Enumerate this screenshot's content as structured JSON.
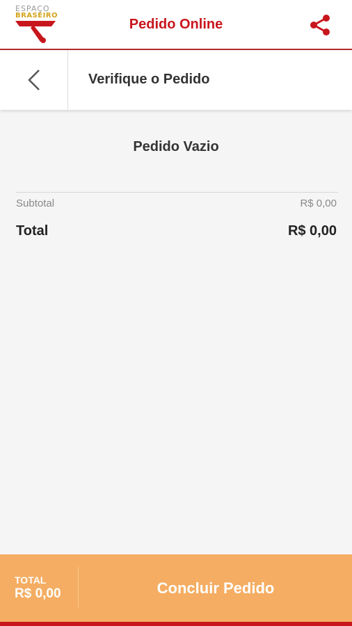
{
  "header": {
    "logo_text_top": "ESPAÇO",
    "logo_text_bottom": "BRASEIRO",
    "title": "Pedido Online",
    "share_icon": "share-icon",
    "accent_color": "#c8161d"
  },
  "subheader": {
    "back_icon": "chevron-left-icon",
    "title": "Verifique o Pedido"
  },
  "order": {
    "empty_message": "Pedido Vazio",
    "subtotal_label": "Subtotal",
    "subtotal_value": "R$ 0,00",
    "total_label": "Total",
    "total_value": "R$ 0,00"
  },
  "footer": {
    "total_label": "TOTAL",
    "total_value": "R$ 0,00",
    "button_label": "Concluir Pedido",
    "background_color": "#f4ad62"
  }
}
